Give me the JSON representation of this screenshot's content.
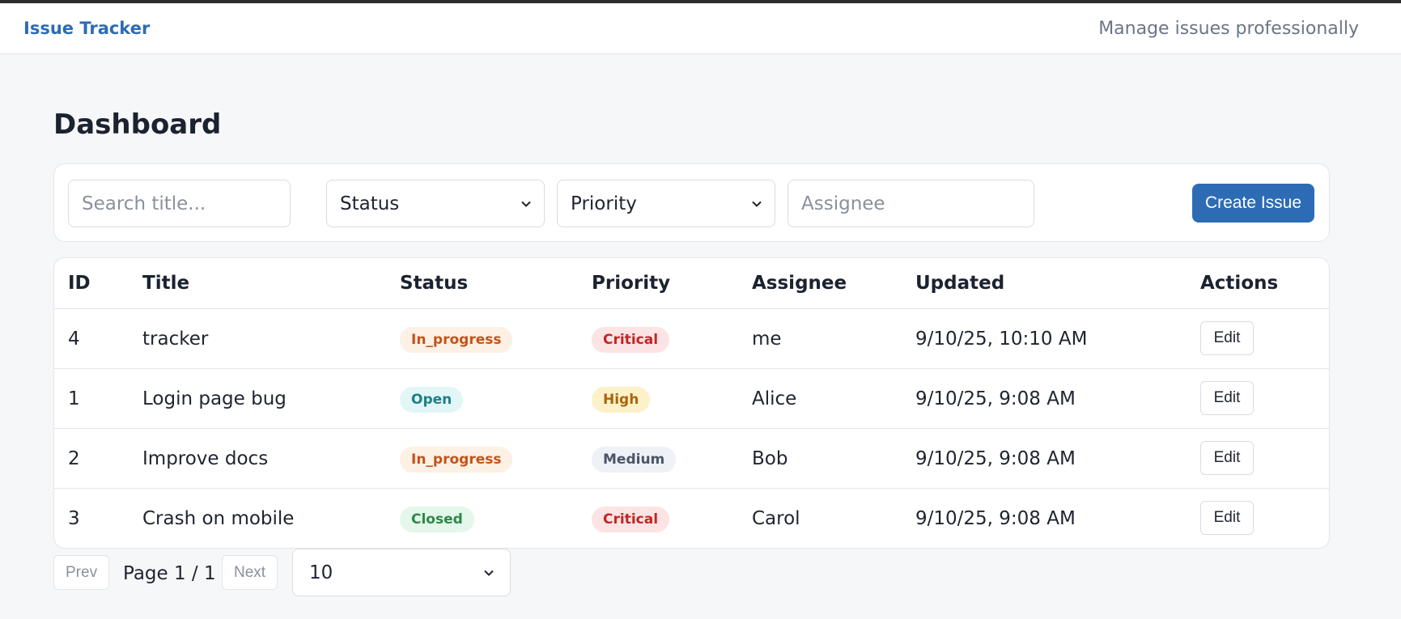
{
  "header": {
    "brand": "Issue Tracker",
    "tagline": "Manage issues professionally"
  },
  "page": {
    "title": "Dashboard"
  },
  "filters": {
    "search_placeholder": "Search title...",
    "status_selected": "Status",
    "priority_selected": "Priority",
    "assignee_placeholder": "Assignee",
    "create_label": "Create Issue"
  },
  "table": {
    "headers": {
      "id": "ID",
      "title": "Title",
      "status": "Status",
      "priority": "Priority",
      "assignee": "Assignee",
      "updated": "Updated",
      "actions": "Actions"
    },
    "rows": [
      {
        "id": "4",
        "title": "tracker",
        "status": "In_progress",
        "priority": "Critical",
        "assignee": "me",
        "updated": "9/10/25, 10:10 AM",
        "action": "Edit"
      },
      {
        "id": "1",
        "title": "Login page bug",
        "status": "Open",
        "priority": "High",
        "assignee": "Alice",
        "updated": "9/10/25, 9:08 AM",
        "action": "Edit"
      },
      {
        "id": "2",
        "title": "Improve docs",
        "status": "In_progress",
        "priority": "Medium",
        "assignee": "Bob",
        "updated": "9/10/25, 9:08 AM",
        "action": "Edit"
      },
      {
        "id": "3",
        "title": "Crash on mobile",
        "status": "Closed",
        "priority": "Critical",
        "assignee": "Carol",
        "updated": "9/10/25, 9:08 AM",
        "action": "Edit"
      }
    ]
  },
  "pagination": {
    "prev_label": "Prev",
    "page_label": "Page 1 / 1",
    "next_label": "Next",
    "page_size": "10"
  },
  "colors": {
    "brand": "#2d6cb5",
    "badge_in_progress_bg": "#fdf0e4",
    "badge_in_progress_fg": "#c2541a",
    "badge_open_bg": "#e3f6f7",
    "badge_open_fg": "#1c7f86",
    "badge_closed_bg": "#e5f6ea",
    "badge_closed_fg": "#2a8a47",
    "badge_critical_bg": "#fde4e4",
    "badge_critical_fg": "#c22525",
    "badge_high_bg": "#fdf1c9",
    "badge_high_fg": "#a8650b",
    "badge_medium_bg": "#eef1f5",
    "badge_medium_fg": "#4a5568"
  }
}
